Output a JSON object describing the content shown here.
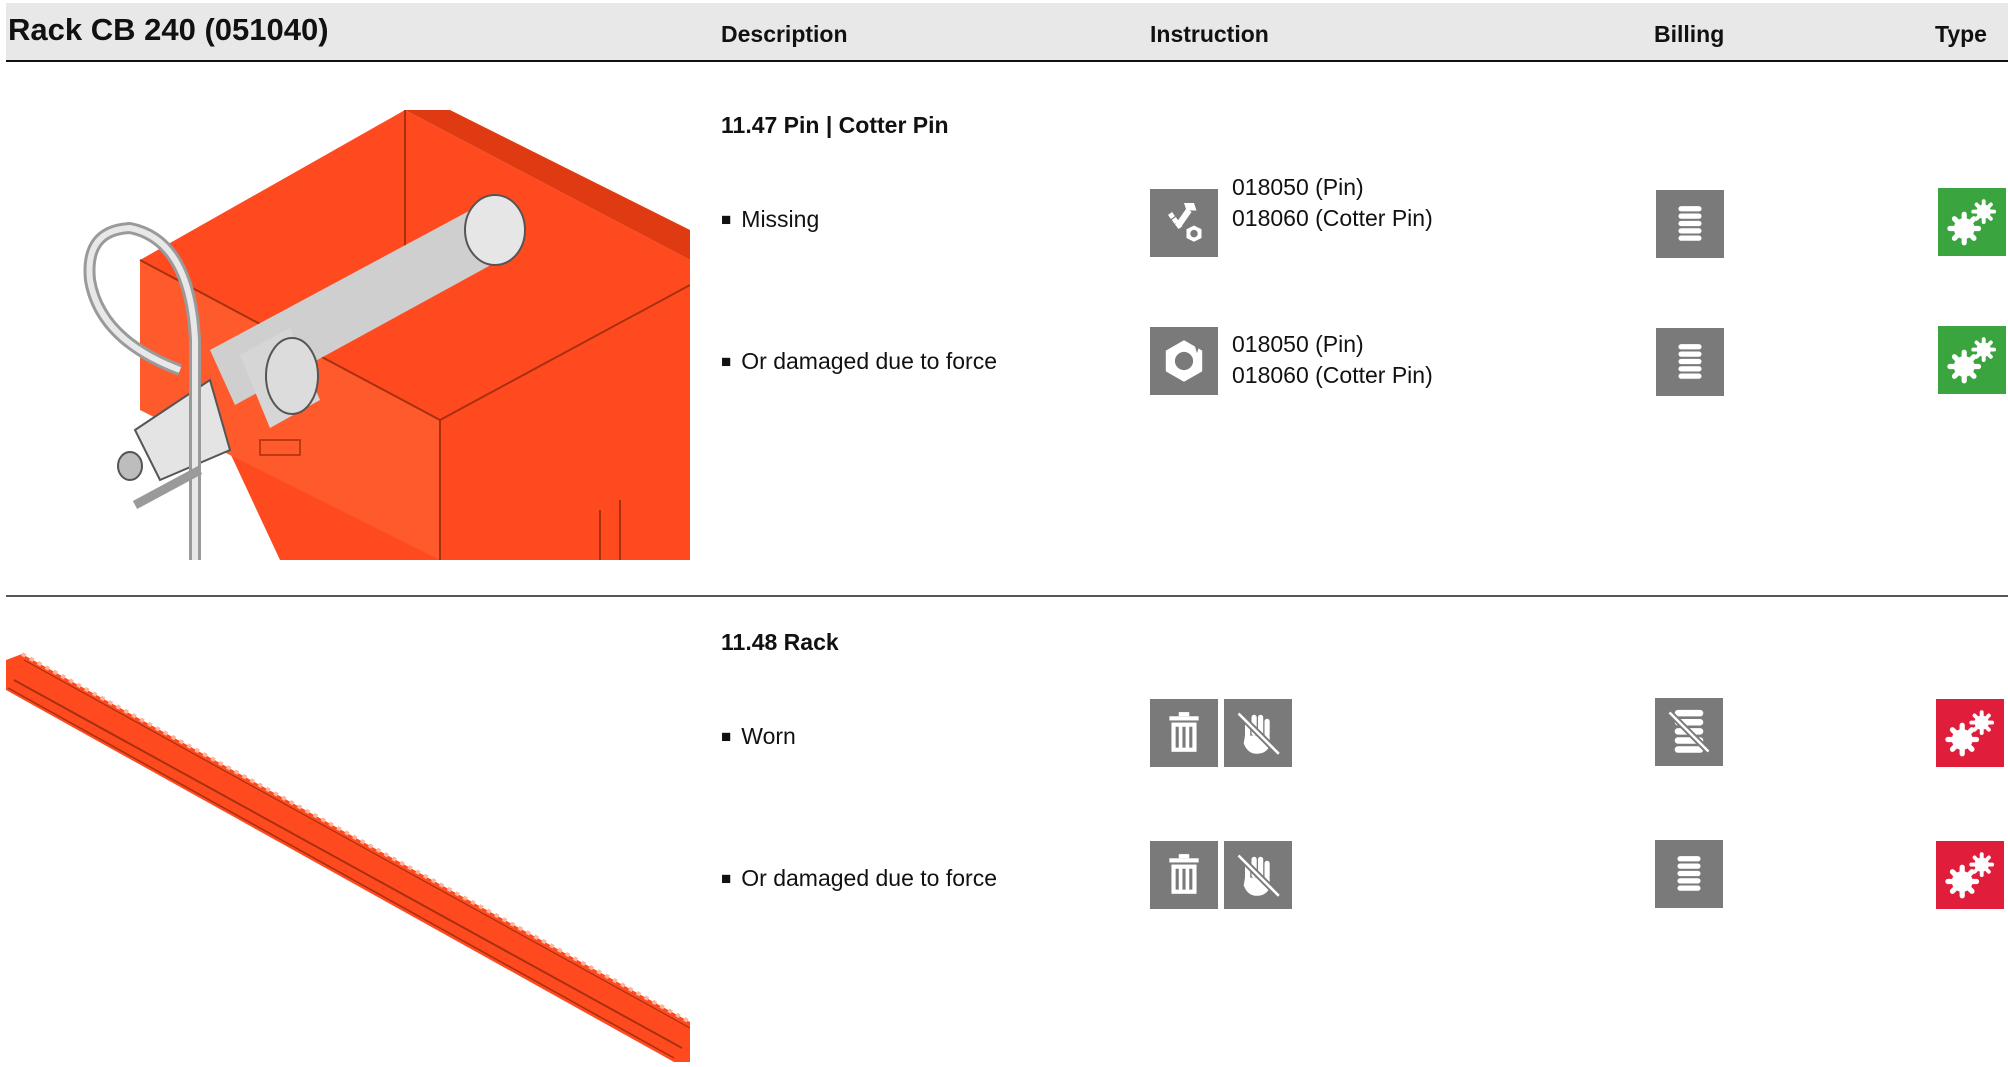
{
  "header": {
    "title": "Rack CB 240 (051040)",
    "col_description": "Description",
    "col_instruction": "Instruction",
    "col_billing": "Billing",
    "col_type": "Type"
  },
  "sections": [
    {
      "title": "11.47 Pin | Cotter Pin",
      "items": [
        {
          "description": "Missing",
          "instruction_icons": [
            "bolt-nut-icon"
          ],
          "parts": [
            "018050 (Pin)",
            "018060 (Cotter Pin)"
          ],
          "billing_icon": "billing-stack-icon",
          "type_icon": "gears-icon",
          "type_color": "#3aa53f"
        },
        {
          "description": "Or damaged due to force",
          "instruction_icons": [
            "broken-nut-icon"
          ],
          "parts": [
            "018050 (Pin)",
            "018060 (Cotter Pin)"
          ],
          "billing_icon": "billing-stack-icon",
          "type_icon": "gears-icon",
          "type_color": "#3aa53f"
        }
      ]
    },
    {
      "title": "11.48 Rack",
      "items": [
        {
          "description": "Worn",
          "instruction_icons": [
            "trash-icon",
            "no-hand-icon"
          ],
          "parts": [],
          "billing_icon": "no-billing-icon",
          "type_icon": "gears-icon",
          "type_color": "#e01e3c"
        },
        {
          "description": "Or damaged due to force",
          "instruction_icons": [
            "trash-icon",
            "no-hand-icon"
          ],
          "parts": [],
          "billing_icon": "billing-stack-icon",
          "type_icon": "gears-icon",
          "type_color": "#e01e3c"
        }
      ]
    }
  ],
  "colors": {
    "header_bg": "#e8e8e8",
    "icon_bg": "#7a7a7a",
    "part_orange": "#ff4a20",
    "ok_green": "#3aa53f",
    "alert_red": "#e01e3c"
  }
}
